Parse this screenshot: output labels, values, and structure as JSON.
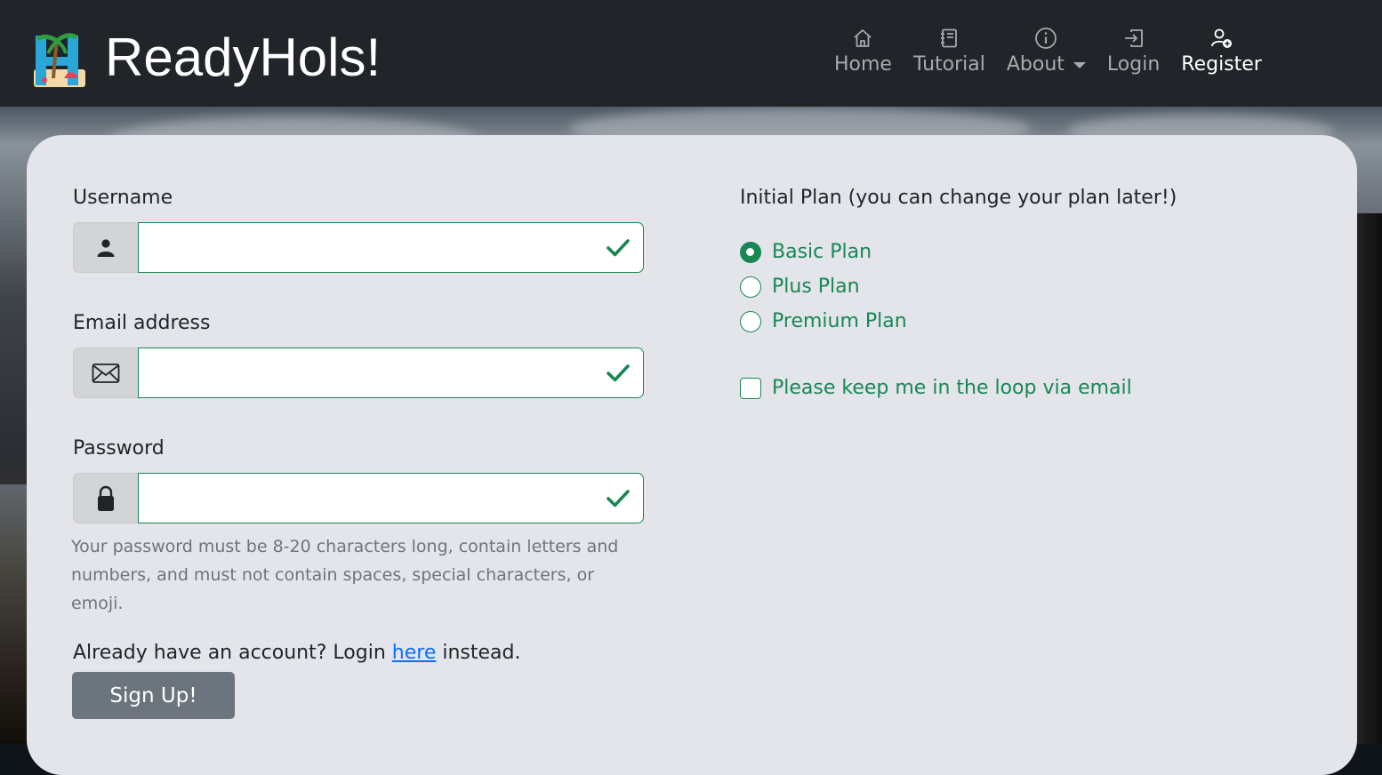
{
  "brand": {
    "name": "ReadyHols!"
  },
  "nav": {
    "items": [
      {
        "label": "Home",
        "icon": "house-icon"
      },
      {
        "label": "Tutorial",
        "icon": "journal-icon"
      },
      {
        "label": "About",
        "icon": "info-circle-icon"
      },
      {
        "label": "Login",
        "icon": "box-arrow-in-right-icon"
      },
      {
        "label": "Register",
        "icon": "person-plus-icon"
      }
    ]
  },
  "form": {
    "username": {
      "label": "Username",
      "value": "",
      "icon": "person-icon"
    },
    "email": {
      "label": "Email address",
      "value": "",
      "icon": "envelope-icon"
    },
    "password": {
      "label": "Password",
      "value": "",
      "icon": "lock-icon",
      "help": "Your password must be 8-20 characters long, contain letters and numbers, and must not contain spaces, special characters, or emoji."
    },
    "already": {
      "prefix": "Already have an account? Login ",
      "link": "here",
      "suffix": " instead."
    },
    "submit_label": "Sign Up!"
  },
  "plans": {
    "title": "Initial Plan (you can change your plan later!)",
    "options": [
      {
        "label": "Basic Plan",
        "checked": true
      },
      {
        "label": "Plus Plan",
        "checked": false
      },
      {
        "label": "Premium Plan",
        "checked": false
      }
    ],
    "newsletter": {
      "label": "Please keep me in the loop via email",
      "checked": false
    }
  },
  "colors": {
    "navbar": "#212529",
    "valid": "#198754",
    "link": "#0d6efd",
    "button": "#6c757d",
    "card": "#e3e5ea"
  }
}
